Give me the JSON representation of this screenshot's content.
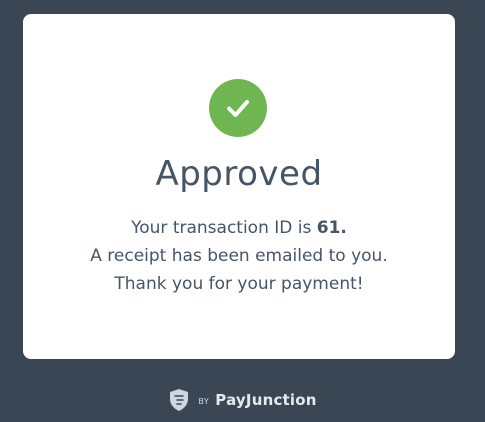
{
  "status": {
    "title": "Approved",
    "icon": "checkmark-icon",
    "icon_color": "#6fb653"
  },
  "message": {
    "transaction_prefix": "Your transaction ID is ",
    "transaction_id": "61.",
    "receipt_line": "A receipt has been emailed to you.",
    "thanks_line": "Thank you for your payment!"
  },
  "footer": {
    "by_label": "BY",
    "brand_name": "PayJunction",
    "logo_icon": "payjunction-shield-icon"
  },
  "colors": {
    "background": "#3a4654",
    "card": "#ffffff",
    "text": "#465566",
    "success": "#6fb653"
  }
}
